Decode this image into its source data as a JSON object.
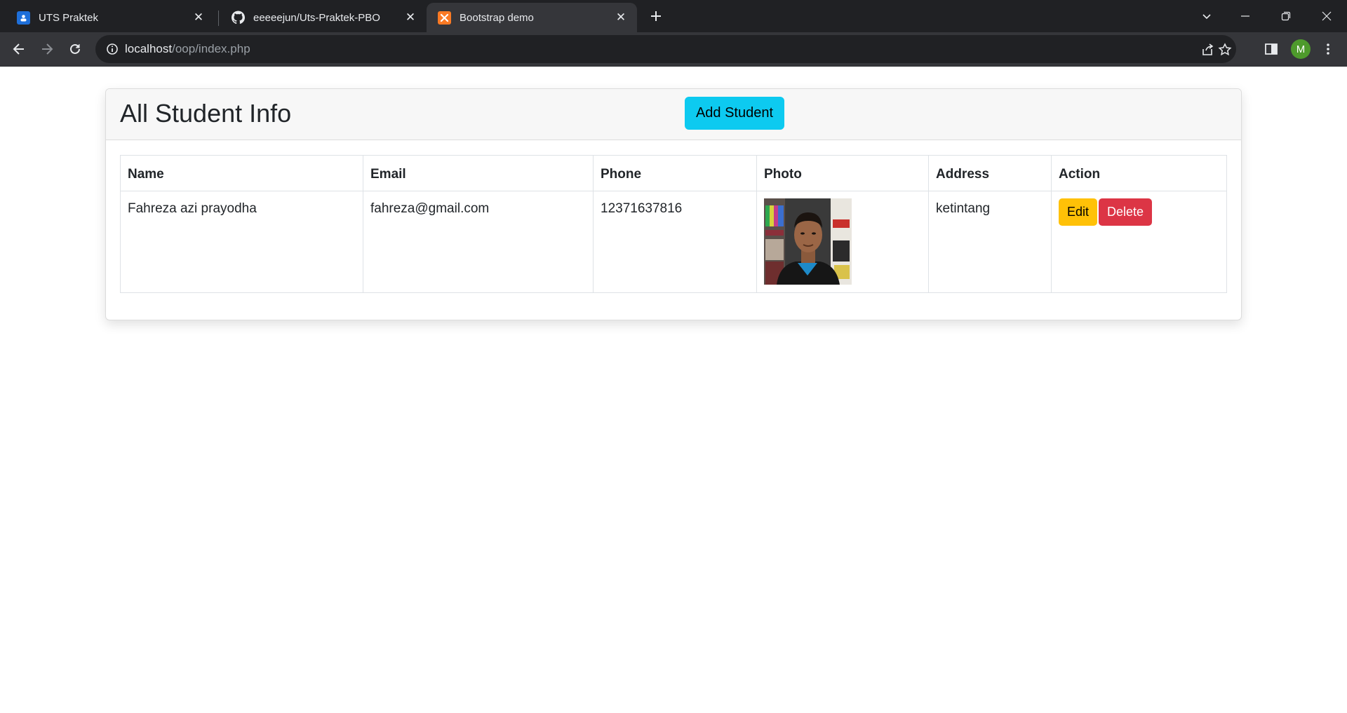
{
  "browser": {
    "tabs": [
      {
        "title": "UTS Praktek",
        "icon": "google-classroom-icon",
        "active": false
      },
      {
        "title": "eeeeejun/Uts-Praktek-PBO",
        "icon": "github-icon",
        "active": false
      },
      {
        "title": "Bootstrap demo",
        "icon": "xampp-icon",
        "active": true
      }
    ],
    "url": {
      "host": "localhost",
      "path": "/oop/index.php"
    },
    "profile_initial": "M"
  },
  "page": {
    "title": "All Student Info",
    "add_button": "Add Student",
    "table": {
      "headers": [
        "Name",
        "Email",
        "Phone",
        "Photo",
        "Address",
        "Action"
      ],
      "rows": [
        {
          "name": "Fahreza azi prayodha",
          "email": "fahreza@gmail.com",
          "phone": "12371637816",
          "photo_alt": "student photo",
          "address": "ketintang",
          "edit_label": "Edit",
          "delete_label": "Delete"
        }
      ]
    }
  },
  "colors": {
    "info": "#0dcaf0",
    "warning": "#ffc107",
    "danger": "#dc3545"
  }
}
